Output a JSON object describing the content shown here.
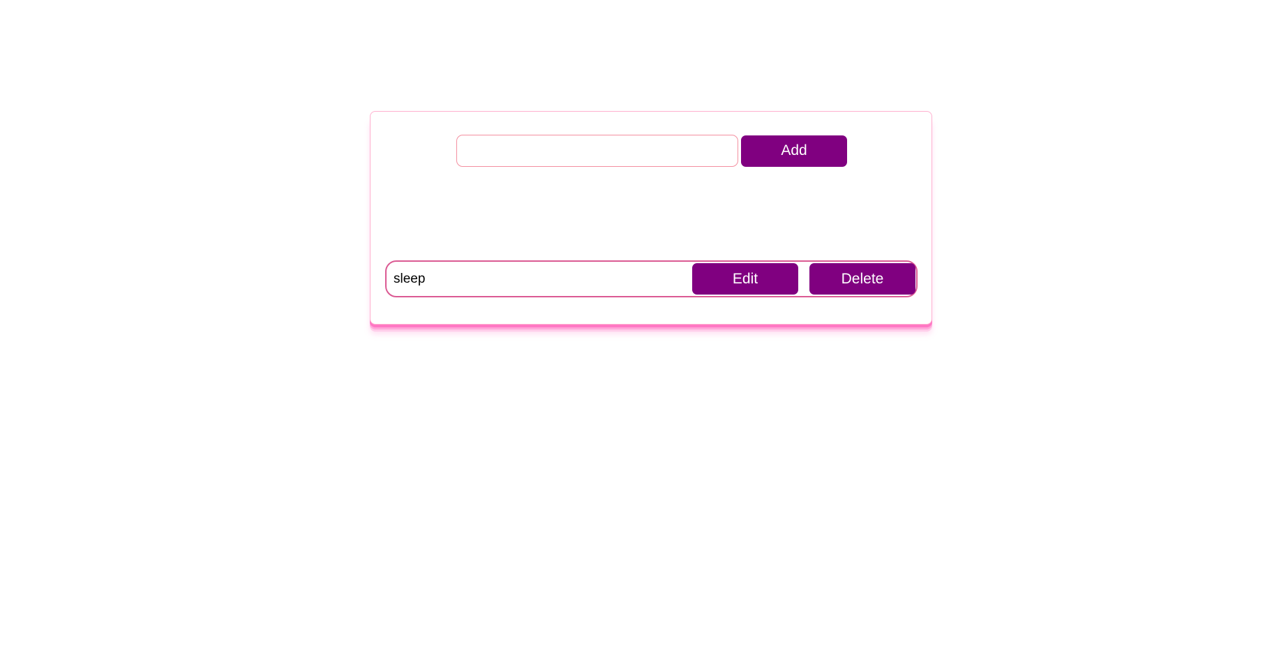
{
  "colors": {
    "accent": "#800080",
    "border_pink": "#ffb0cf",
    "item_border": "#db5a93",
    "shadow_pink": "#ff77c4"
  },
  "form": {
    "input_value": "",
    "input_placeholder": "",
    "add_label": "Add"
  },
  "todos": [
    {
      "text": "sleep",
      "edit_label": "Edit",
      "delete_label": "Delete"
    }
  ]
}
